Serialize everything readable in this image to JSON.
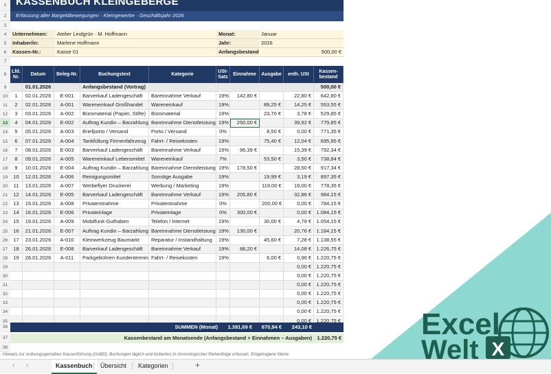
{
  "sheet": {
    "title": "KASSENBUCH KLEINGEBERGE",
    "subtitle": "Erfassung aller Bargeldbewegungen  ·  Kleingewerbe  ·  Geschäftsjahr 2026",
    "info": {
      "unternehmen_label": "Unternehmen:",
      "unternehmen": "Atelier Lindgrün · M. Hoffmann",
      "inhaber_label": "Inhaber/in:",
      "inhaber": "Marlene Hoffmann",
      "kasse_label": "Kassen-Nr.:",
      "kasse": "Kasse 01",
      "monat_label": "Monat:",
      "monat": "Januar",
      "jahr_label": "Jahr:",
      "jahr": "2026",
      "anfang_label": "Anfangsbestand",
      "anfang": "500,00 €"
    },
    "headers": [
      "Lfd. Nr.",
      "Datum",
      "Beleg-Nr.",
      "Buchungstext",
      "Kategorie",
      "USt-Satz",
      "Einnahme",
      "Ausgabe",
      "enth. USt",
      "Kassen-bestand"
    ],
    "opening": {
      "date": "01.01.2026",
      "text": "Anfangsbestand (Vortrag)",
      "balance": "500,00 €"
    },
    "rows": [
      [
        "1",
        "02.01.2026",
        "E-001",
        "Barverkauf Ladengeschäft",
        "Bareinnahme Verkauf",
        "19%",
        "142,80 €",
        "",
        "22,80 €",
        "642,80 €"
      ],
      [
        "2",
        "02.01.2026",
        "A-001",
        "Wareneinkauf Großhandel",
        "Wareneinkauf",
        "19%",
        "",
        "89,25 €",
        "14,25 €",
        "553,55 €"
      ],
      [
        "3",
        "03.01.2026",
        "A-002",
        "Büromaterial (Papier, Stifte)",
        "Büromaterial",
        "19%",
        "",
        "23,70 €",
        "3,78 €",
        "529,85 €"
      ],
      [
        "4",
        "04.01.2026",
        "E-002",
        "Auftrag Kundin – Barzahlung",
        "Bareinnahme Dienstleistung",
        "19%",
        "250,00 €",
        "",
        "39,92 €",
        "779,85 €"
      ],
      [
        "5",
        "05.01.2026",
        "A-003",
        "Briefporto / Versand",
        "Porto / Versand",
        "0%",
        "",
        "8,50 €",
        "0,00 €",
        "771,35 €"
      ],
      [
        "6",
        "07.01.2026",
        "A-004",
        "Tankfüllung Firmenfahrzeug",
        "Fahrt- / Reisekosten",
        "19%",
        "",
        "75,40 €",
        "12,04 €",
        "695,95 €"
      ],
      [
        "7",
        "08.01.2026",
        "E-003",
        "Barverkauf Ladengeschäft",
        "Bareinnahme Verkauf",
        "19%",
        "96,39 €",
        "",
        "15,39 €",
        "792,34 €"
      ],
      [
        "8",
        "09.01.2026",
        "A-005",
        "Wareneinkauf Lebensmittel",
        "Wareneinkauf",
        "7%",
        "",
        "53,50 €",
        "3,50 €",
        "738,84 €"
      ],
      [
        "9",
        "10.01.2026",
        "E-004",
        "Auftrag Kundin – Barzahlung",
        "Bareinnahme Dienstleistung",
        "19%",
        "178,50 €",
        "",
        "28,50 €",
        "917,34 €"
      ],
      [
        "10",
        "12.01.2026",
        "A-006",
        "Reinigungsmittel",
        "Sonstige Ausgabe",
        "19%",
        "",
        "19,99 €",
        "3,19 €",
        "897,35 €"
      ],
      [
        "11",
        "13.01.2026",
        "A-007",
        "Werbeflyer Druckerei",
        "Werbung / Marketing",
        "19%",
        "",
        "119,00 €",
        "19,00 €",
        "778,35 €"
      ],
      [
        "12",
        "14.01.2026",
        "E-005",
        "Barverkauf Ladengeschäft",
        "Bareinnahme Verkauf",
        "19%",
        "205,80 €",
        "",
        "32,86 €",
        "984,15 €"
      ],
      [
        "13",
        "15.01.2026",
        "A-008",
        "Privatentnahme",
        "Privatentnahme",
        "0%",
        "",
        "200,00 €",
        "0,00 €",
        "784,15 €"
      ],
      [
        "14",
        "16.01.2026",
        "E-006",
        "Privateinlage",
        "Privateinlage",
        "0%",
        "300,00 €",
        "",
        "0,00 €",
        "1.084,15 €"
      ],
      [
        "15",
        "19.01.2026",
        "A-009",
        "Mobilfunk-Guthaben",
        "Telefon / Internet",
        "19%",
        "",
        "30,00 €",
        "4,79 €",
        "1.054,15 €"
      ],
      [
        "16",
        "21.01.2026",
        "E-007",
        "Auftrag Kundin – Barzahlung",
        "Bareinnahme Dienstleistung",
        "19%",
        "130,00 €",
        "",
        "20,76 €",
        "1.184,15 €"
      ],
      [
        "17",
        "23.01.2026",
        "A-010",
        "Kleinwerkzeug Baumarkt",
        "Reparatur / Instandhaltung",
        "19%",
        "",
        "45,60 €",
        "7,28 €",
        "1.138,55 €"
      ],
      [
        "18",
        "26.01.2026",
        "E-008",
        "Barverkauf Ladengeschäft",
        "Bareinnahme Verkauf",
        "19%",
        "88,20 €",
        "",
        "14,08 €",
        "1.226,75 €"
      ],
      [
        "19",
        "28.01.2026",
        "A-011",
        "Parkgebühren Kundentermin",
        "Fahrt- / Reisekosten",
        "19%",
        "",
        "6,00 €",
        "0,96 €",
        "1.220,75 €"
      ],
      [
        "",
        "",
        "",
        "",
        "",
        "",
        "",
        "",
        "0,00 €",
        "1.220,75 €"
      ],
      [
        "",
        "",
        "",
        "",
        "",
        "",
        "",
        "",
        "0,00 €",
        "1.220,75 €"
      ],
      [
        "",
        "",
        "",
        "",
        "",
        "",
        "",
        "",
        "0,00 €",
        "1.220,75 €"
      ],
      [
        "",
        "",
        "",
        "",
        "",
        "",
        "",
        "",
        "0,00 €",
        "1.220,75 €"
      ],
      [
        "",
        "",
        "",
        "",
        "",
        "",
        "",
        "",
        "0,00 €",
        "1.220,75 €"
      ],
      [
        "",
        "",
        "",
        "",
        "",
        "",
        "",
        "",
        "0,00 €",
        "1.220,75 €"
      ],
      [
        "",
        "",
        "",
        "",
        "",
        "",
        "",
        "",
        "0,00 €",
        "1.220,75 €"
      ]
    ],
    "sums": {
      "label": "SUMMEN (Monat)",
      "einnahme": "1.391,69 €",
      "ausgabe": "670,94 €",
      "ust": "243,10 €"
    },
    "month_end": {
      "label": "Kassenbestand am Monatsende  (Anfangsbestand + Einnahmen – Ausgaben)",
      "value": "1.220,75 €"
    },
    "note": "Hinweis zur ordnungsgemäßen Kassenführung (GoBD): Buchungen täglich und lückenlos in chronologischer Reihenfolge erfassen. Eingetragene Werte"
  },
  "row_numbers": [
    "1",
    "2",
    "3",
    "4",
    "5",
    "6",
    "7",
    "8",
    "9",
    "10",
    "11",
    "12",
    "13",
    "14",
    "15",
    "16",
    "17",
    "18",
    "19",
    "20",
    "21",
    "22",
    "23",
    "24",
    "25",
    "26",
    "27",
    "28",
    "29",
    "30",
    "31",
    "32",
    "33",
    "34",
    "35",
    "36",
    "37",
    "38"
  ],
  "active_row": "13",
  "tabs": [
    "Kassenbuch",
    "Übersicht",
    "Kategorien"
  ],
  "add_sheet": "+",
  "logo": {
    "line1": "Excel",
    "line2": "Welt",
    "badge": "X"
  },
  "colors": {
    "header": "#1f3864",
    "accent": "#217346",
    "logo_bg": "#8ed8d2",
    "logo_text": "#1f5f4f"
  }
}
